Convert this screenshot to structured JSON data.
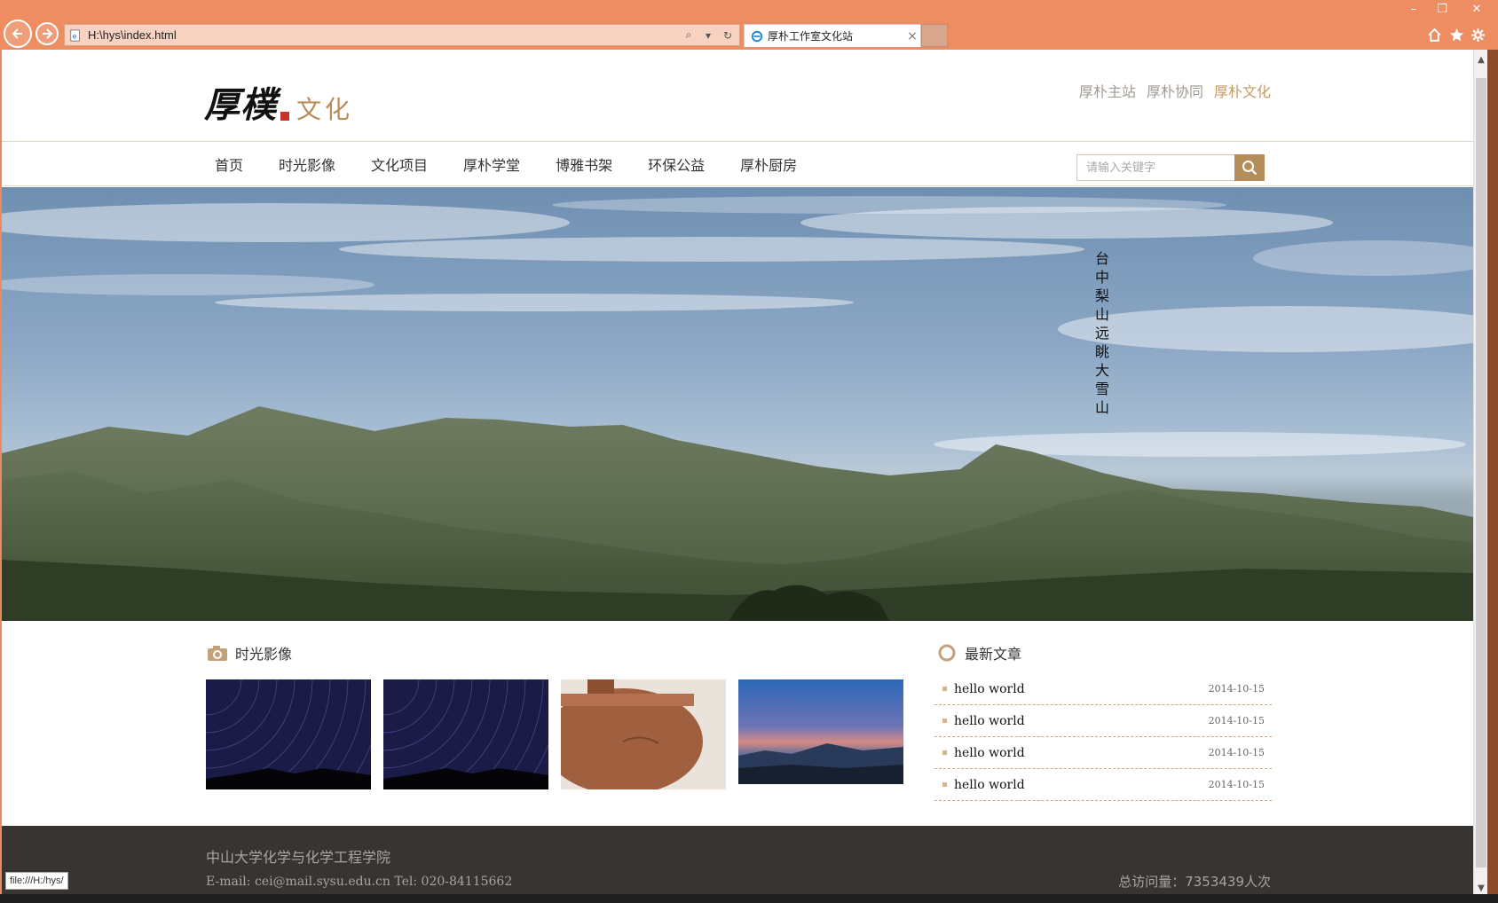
{
  "browser": {
    "address_url": "H:\\hys\\index.html",
    "tab_title": "厚朴工作室文化站",
    "status_text": "file:///H:/hys/",
    "colors": {
      "chrome": "#ee8c62",
      "address_bg": "#f8d2c0"
    }
  },
  "header": {
    "logo_main": "厚樸",
    "logo_sub": "文化",
    "top_links": [
      "厚朴主站",
      "厚朴协同",
      "厚朴文化"
    ],
    "active_top_link": "厚朴文化"
  },
  "nav": {
    "items": [
      "首页",
      "时光影像",
      "文化项目",
      "厚朴学堂",
      "博雅书架",
      "环保公益",
      "厚朴厨房"
    ]
  },
  "search": {
    "placeholder": "请输入关键字"
  },
  "banner": {
    "caption": "台中梨山远眺大雪山"
  },
  "photos": {
    "title": "时光影像",
    "items": [
      "star-trail-photo",
      "star-trail-photo",
      "teapot-photo",
      "dusk-mountains-photo"
    ]
  },
  "articles": {
    "title": "最新文章",
    "items": [
      {
        "title": "hello world",
        "date": "2014-10-15"
      },
      {
        "title": "hello world",
        "date": "2014-10-15"
      },
      {
        "title": "hello world",
        "date": "2014-10-15"
      },
      {
        "title": "hello world",
        "date": "2014-10-15"
      }
    ]
  },
  "footer": {
    "org": "中山大学化学与化学工程学院",
    "contact": "E-mail: cei@mail.sysu.edu.cn Tel: 020-84115662",
    "visits": "总访问量：7353439人次"
  },
  "theme": {
    "accent": "#b48d5a",
    "footer_bg": "#373431",
    "dash": "#c8a782"
  }
}
